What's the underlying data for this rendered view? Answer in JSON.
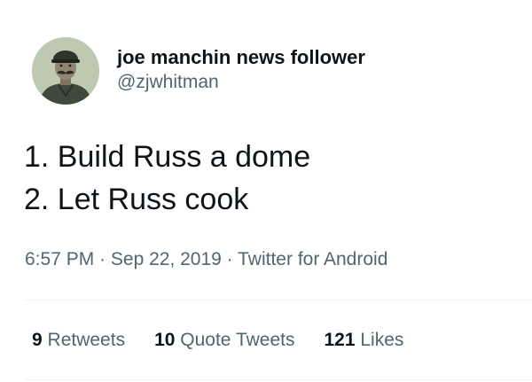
{
  "author": {
    "display_name": "joe manchin news follower",
    "handle": "@zjwhitman",
    "avatar_icon": "profile-photo-icon"
  },
  "tweet": {
    "lines": [
      "1. Build Russ a dome",
      "2. Let Russ cook"
    ],
    "time": "6:57 PM",
    "separator": " · ",
    "date": "Sep 22, 2019",
    "source": "Twitter for Android"
  },
  "stats": {
    "retweets_count": "9",
    "retweets_label": "Retweets",
    "quote_count": "10",
    "quote_label": "Quote Tweets",
    "likes_count": "121",
    "likes_label": "Likes"
  },
  "colors": {
    "text_primary": "#0f1419",
    "text_secondary": "#536471",
    "divider": "#eff3f4"
  }
}
